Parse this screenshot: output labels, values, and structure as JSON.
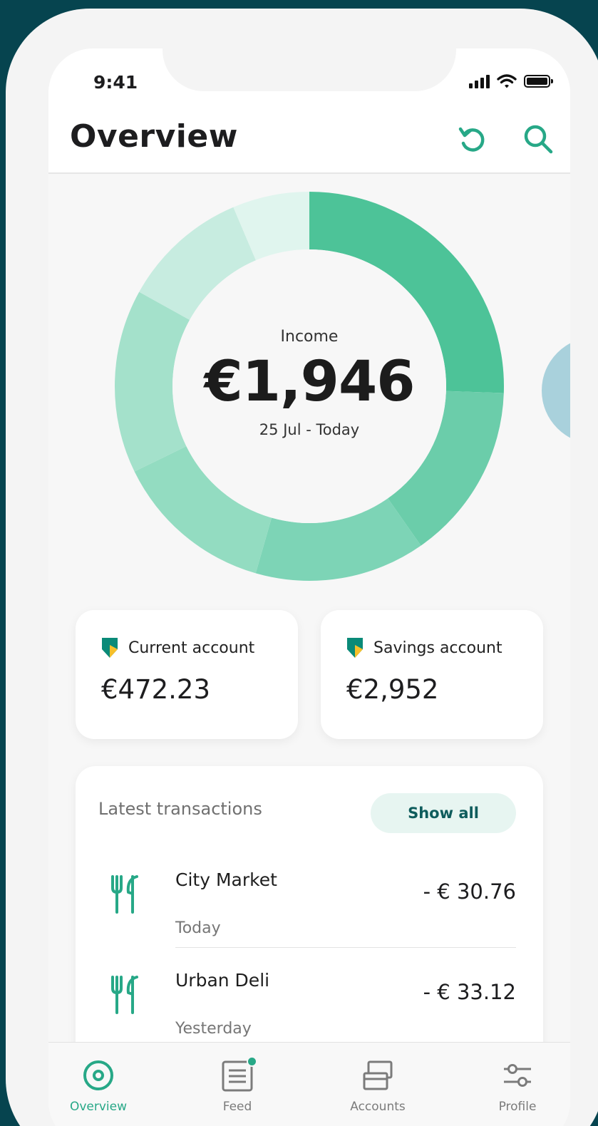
{
  "status_bar": {
    "time": "9:41",
    "signal_icon": "signal-icon",
    "wifi_icon": "wifi-icon",
    "battery_icon": "battery-icon"
  },
  "header": {
    "title": "Overview",
    "refresh_icon": "refresh-icon",
    "search_icon": "search-icon"
  },
  "summary": {
    "label": "Income",
    "amount": "€1,946",
    "range": "25 Jul - Today"
  },
  "chart_data": {
    "type": "pie",
    "style": "donut",
    "colors": [
      "#4dc398",
      "#6bcdaa",
      "#7dd4b6",
      "#93dcc1",
      "#a4e1cb",
      "#c7ece0",
      "#e0f5ee"
    ]
  },
  "accounts": [
    {
      "name": "Current account",
      "balance": "€472.23",
      "icon": "bank-shield-icon"
    },
    {
      "name": "Savings account",
      "balance": "€2,952",
      "icon": "bank-shield-icon"
    }
  ],
  "transactions": {
    "title": "Latest transactions",
    "show_all": "Show all",
    "items": [
      {
        "name": "City Market",
        "date": "Today",
        "amount": "- € 30.76",
        "icon": "restaurant-icon"
      },
      {
        "name": "Urban Deli",
        "date": "Yesterday",
        "amount": "- € 33.12",
        "icon": "restaurant-icon"
      }
    ]
  },
  "tabs": [
    {
      "label": "Overview",
      "icon": "overview-icon",
      "active": true
    },
    {
      "label": "Feed",
      "icon": "feed-icon",
      "active": false,
      "notification": true
    },
    {
      "label": "Accounts",
      "icon": "accounts-icon",
      "active": false
    },
    {
      "label": "Profile",
      "icon": "profile-icon",
      "active": false
    }
  ],
  "colors": {
    "accent": "#27a887",
    "background": "#06444f",
    "peek_circle": "#a9d1dc"
  }
}
